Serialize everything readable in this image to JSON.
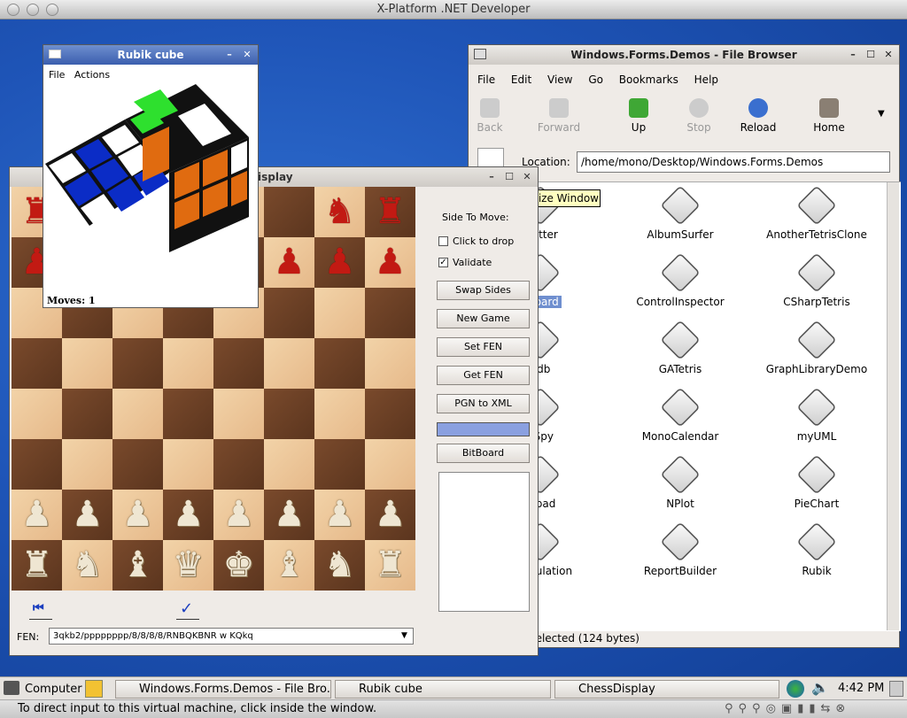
{
  "mac": {
    "title": "X-Platform .NET Developer"
  },
  "file_browser": {
    "title": "Windows.Forms.Demos - File Browser",
    "menu": [
      "File",
      "Edit",
      "View",
      "Go",
      "Bookmarks",
      "Help"
    ],
    "toolbar": {
      "back": "Back",
      "forward": "Forward",
      "up": "Up",
      "stop": "Stop",
      "reload": "Reload",
      "home": "Home"
    },
    "location_label": "Location:",
    "location_value": "/home/mono/Desktop/Windows.Forms.Demos",
    "tooltip": "Maximize Window",
    "items": [
      [
        "Plotter",
        "AlbumSurfer",
        "AnotherTetrisClone"
      ],
      [
        "sBoard",
        "ControlInspector",
        "CSharpTetris"
      ],
      [
        "edb",
        "GATetris",
        "GraphLibraryDemo"
      ],
      [
        "nSpy",
        "MonoCalendar",
        "myUML"
      ],
      [
        "tepad",
        "NPlot",
        "PieChart"
      ],
      [
        "riangulation",
        "ReportBuilder",
        "Rubik"
      ]
    ],
    "status": "\" selected (124 bytes)"
  },
  "chess": {
    "title": "isplay",
    "side_to_move": "Side To Move:",
    "click_to_drop": "Click to drop",
    "validate": "Validate",
    "validate_checked": true,
    "buttons": [
      "Swap Sides",
      "New Game",
      "Set FEN",
      "Get FEN",
      "PGN to XML",
      "",
      "BitBoard"
    ],
    "fen_label": "FEN:",
    "fen_value": "3qkb2/pppppppp/8/8/8/8/RNBQKBNR w KQkq",
    "board": [
      [
        "r",
        "",
        "",
        "",
        "",
        "p_skip",
        "n",
        "r"
      ],
      [
        "p",
        "",
        "",
        "",
        "",
        "p",
        "p",
        "p"
      ],
      [
        "",
        "",
        "",
        "",
        "",
        "",
        "",
        ""
      ],
      [
        "",
        "",
        "",
        "",
        "",
        "",
        "",
        ""
      ],
      [
        "",
        "",
        "",
        "",
        "",
        "",
        "",
        ""
      ],
      [
        "",
        "",
        "",
        "",
        "",
        "",
        "",
        ""
      ],
      [
        "P",
        "P",
        "P",
        "P",
        "P",
        "P",
        "P",
        "P"
      ],
      [
        "R",
        "N",
        "B",
        "Q",
        "K",
        "B",
        "N",
        "R"
      ]
    ]
  },
  "rubik": {
    "title": "Rubik cube",
    "menu": [
      "File",
      "Actions"
    ],
    "moves": "Moves: 1"
  },
  "taskbar": {
    "computer": "Computer",
    "tasks": [
      "Windows.Forms.Demos - File Bro...",
      "Rubik cube",
      "ChessDisplay"
    ],
    "clock": "4:42 PM"
  },
  "statusbar": {
    "text": "To direct input to this virtual machine, click inside the window."
  }
}
